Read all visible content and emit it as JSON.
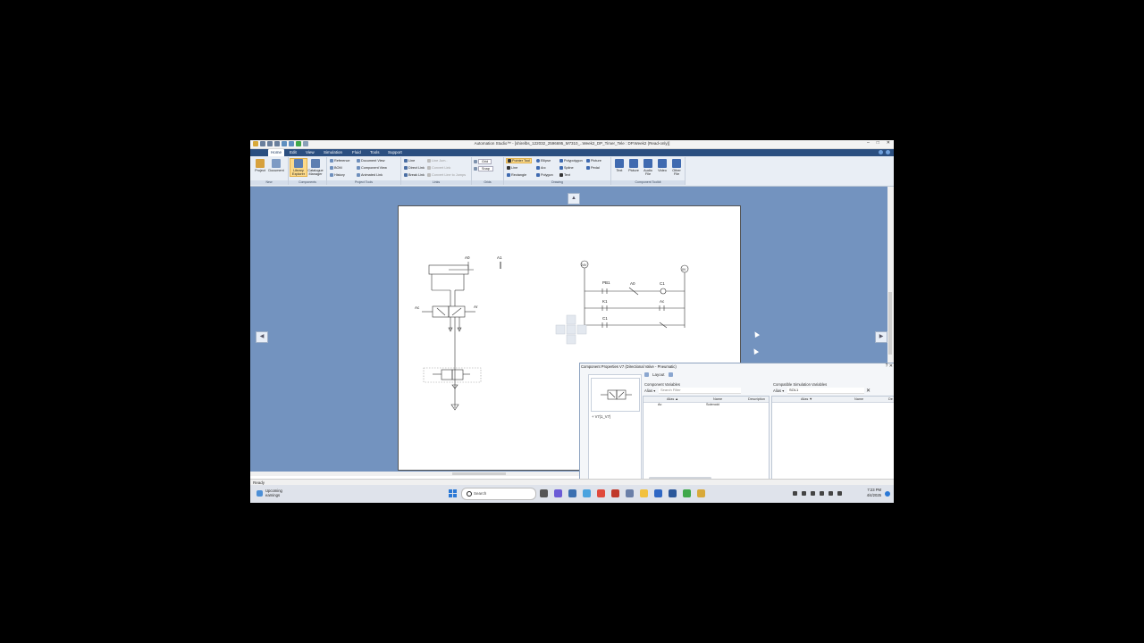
{
  "window": {
    "title": "Automation Studio™ - [shirelbs_122032_2596695_M7310_..Week2_DP_Timer_Tele : DP.Week2 (Read-only)]",
    "controls": [
      "–",
      "□",
      "✕"
    ]
  },
  "menu": {
    "tabs": [
      "Home",
      "Edit",
      "View",
      "Simulation",
      "Fluid",
      "Tools",
      "Support"
    ],
    "active": "Home"
  },
  "ribbon": {
    "new": {
      "caption": "New",
      "project": "Project",
      "document": "Document"
    },
    "components": {
      "caption": "Components",
      "library_explorer": "Library Explorer",
      "catalogue_manager": "Catalogue Manager"
    },
    "project_tools": {
      "caption": "Project Tools",
      "reference": "Reference",
      "bom": "BOM",
      "history": "History",
      "document_view": "Document View",
      "component_view": "Component View",
      "animated_link": "Animated Link"
    },
    "links": {
      "caption": "Links",
      "line": "Line",
      "direct_link": "Direct Link",
      "break_link": "Break Link",
      "line_jum": "Line Jum..",
      "convert_link": "Convert Link",
      "convert_jumps": "Convert Line to Jumps"
    },
    "grids": {
      "caption": "Grids",
      "grid": "Grid",
      "snap": "Snap"
    },
    "drawing": {
      "caption": "Drawing",
      "pointer_tool": "Pointer Tool",
      "line": "Line",
      "rectangle": "Rectangle",
      "ellipse": "Ellipse",
      "arc": "Arc",
      "polygon": "Polygon",
      "polypolygon": "Polypolygon",
      "spline": "Spline",
      "text": "Text",
      "picture": "Picture",
      "pedal": "Pedal"
    },
    "component_toolkit": {
      "caption": "Component Toolkit",
      "text": "Text",
      "picture": "Picture",
      "audio_file": "Audio File",
      "video": "Video",
      "other_file": "Other File"
    }
  },
  "schematic": {
    "cyl_label_a0": "A0",
    "cyl_label_a1": "A1",
    "valve_left": "Ac",
    "valve_right": "Ar",
    "supply_24v": "24V",
    "supply_0v": "0V",
    "pb1": "PB1",
    "a0": "A0",
    "c1": "C1",
    "k1": "K1",
    "ac": "Ac",
    "c1b": "C1"
  },
  "status": {
    "text": "Ready"
  },
  "taskbar": {
    "weather_line1": "Upcoming",
    "weather_line2": "earnings",
    "search_placeholder": "Search",
    "time": "7:23 PM",
    "date": "4/4/2025"
  },
  "properties": {
    "title": "Component Properties V7 (Directional Valve - Pneumatic)",
    "tree_item": "+ V7(1_V7)",
    "data_label": "Data",
    "layout_tab": "Layout",
    "component_variables": {
      "header": "Component Variables",
      "alias": "Alias ▾",
      "filter_placeholder": "Search Filter",
      "columns": [
        "Alias ▲",
        "Name",
        "Description"
      ],
      "rows": [
        {
          "alias": "Ac",
          "name": "Solenoid"
        }
      ]
    },
    "compatible_variables": {
      "header": "Compatible Simulation Variables",
      "alias": "Alias ▾",
      "filter_value": "SOL1",
      "columns": [
        "Alias ▼",
        "Name",
        "De"
      ]
    }
  },
  "colors": {
    "menubar": "#2b4f80",
    "workspace": "#7393bf",
    "ribbon": "#e9eef5",
    "selected": "#fbd98a"
  }
}
